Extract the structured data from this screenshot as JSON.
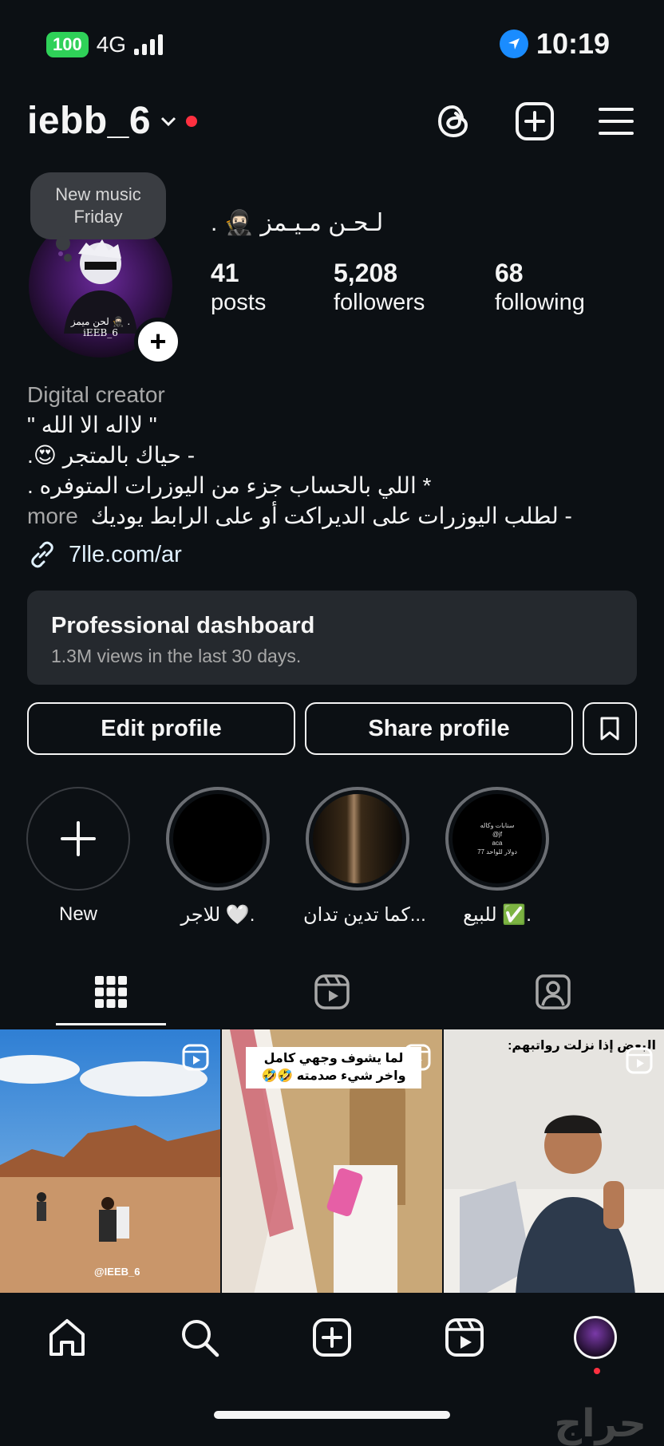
{
  "status_bar": {
    "battery": "100",
    "network": "4G",
    "time": "10:19"
  },
  "header": {
    "username": "iebb_6"
  },
  "profile": {
    "note_line1": "New music",
    "note_line2": "Friday",
    "display_name": "لـحـن مـيـمز 🥷🏻 .",
    "avatar_caption1": "لحن ميمز 🥷🏻 .",
    "avatar_caption2": "iEEB_6",
    "stats": [
      {
        "value": "41",
        "label": "posts"
      },
      {
        "value": "5,208",
        "label": "followers"
      },
      {
        "value": "68",
        "label": "following"
      }
    ]
  },
  "bio": {
    "category": "Digital creator",
    "lines": [
      "\" لااله الا الله \"",
      "- حياك بالمتجر 😍.",
      "* اللي بالحساب جزء من اليوزرات المتوفره .",
      "- لطلب اليوزرات على الديراكت أو على الرابط يوديك"
    ],
    "more": "more",
    "link": "7lle.com/ar"
  },
  "dashboard": {
    "title": "Professional dashboard",
    "subtitle": "1.3M views in the last 30 days."
  },
  "buttons": {
    "edit": "Edit profile",
    "share": "Share profile"
  },
  "highlights": [
    {
      "label": "New"
    },
    {
      "label": "للاجر 🤍."
    },
    {
      "label": "كما تدين تدان..."
    },
    {
      "label": "للبيع ✅."
    }
  ],
  "highlight4_text": [
    "سنابات وكاله",
    "@jf",
    "aca",
    "77 دولار للواحد"
  ],
  "posts": [
    {
      "caption": "@IEEB_6"
    },
    {
      "caption": "لما يشوف وجهي كامل واخر شيء صدمته 🤣🤣"
    },
    {
      "caption": "البعض إذا نزلت رواتبهم:"
    }
  ],
  "watermark": "حراج",
  "colors": {
    "background": "#0c1014",
    "battery": "#2fd158",
    "notification": "#ff3040",
    "location": "#1a8cff"
  }
}
